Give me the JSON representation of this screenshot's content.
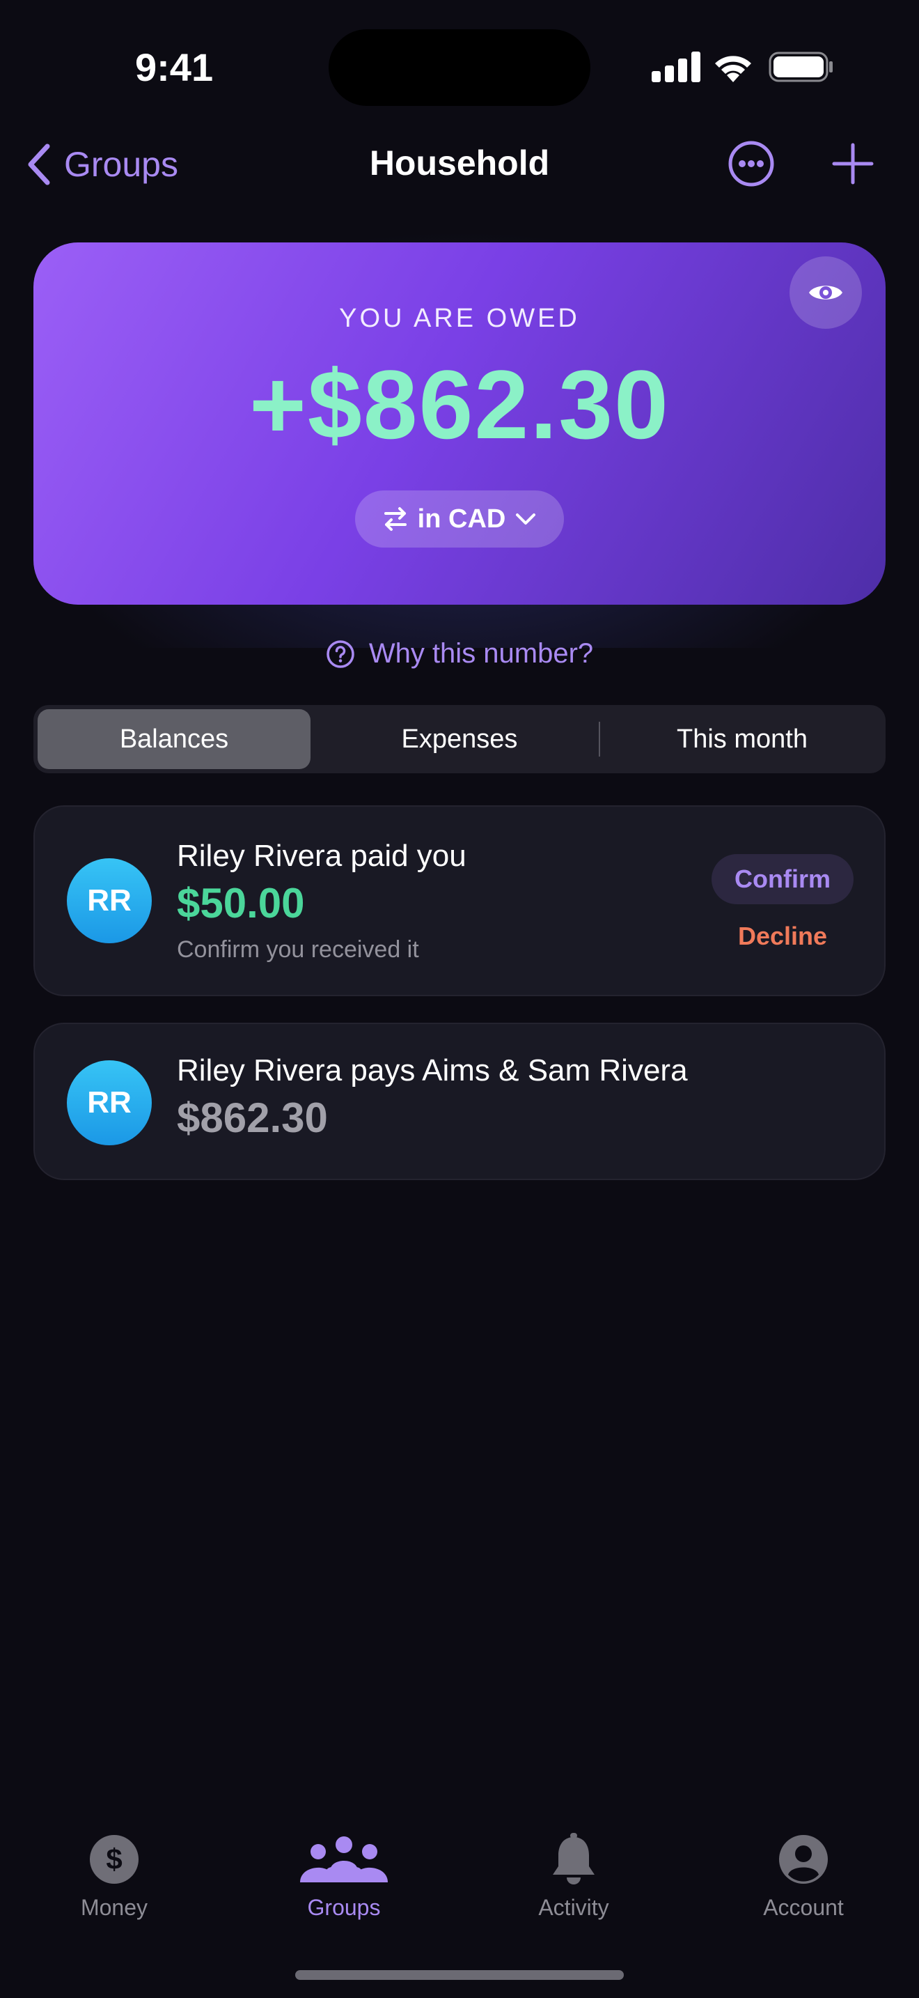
{
  "status_bar": {
    "time": "9:41"
  },
  "header": {
    "back_label": "Groups",
    "title": "Household",
    "icons": [
      "chevron-left-icon",
      "more-icon",
      "plus-icon"
    ]
  },
  "hero": {
    "label": "YOU ARE OWED",
    "amount": "+$862.30",
    "currency_label": "in CAD",
    "icons": [
      "eye-icon",
      "swap-icon",
      "chevron-down-icon"
    ]
  },
  "why_link": {
    "label": "Why this number?",
    "icon": "question-circle-icon"
  },
  "segments": {
    "items": [
      "Balances",
      "Expenses",
      "This month"
    ],
    "selected": "Balances"
  },
  "cards": [
    {
      "avatar_initials": "RR",
      "title": "Riley Rivera paid you",
      "amount": "$50.00",
      "subtitle": "Confirm you received it",
      "confirm_label": "Confirm",
      "decline_label": "Decline"
    },
    {
      "avatar_initials": "RR",
      "title": "Riley Rivera pays Aims & Sam Rivera",
      "amount": "$862.30"
    }
  ],
  "tab_bar": {
    "items": [
      {
        "label": "Money",
        "icon": "dollar-circle-icon"
      },
      {
        "label": "Groups",
        "icon": "people-icon"
      },
      {
        "label": "Activity",
        "icon": "bell-icon"
      },
      {
        "label": "Account",
        "icon": "person-circle-icon"
      }
    ],
    "active": "Groups"
  },
  "colors": {
    "background": "#0c0b13",
    "accent": "#a98af2",
    "positive": "#4bd69a",
    "hero_amount": "#8bf1c7",
    "negative": "#f07a5a",
    "avatar": "#1b98e6"
  }
}
